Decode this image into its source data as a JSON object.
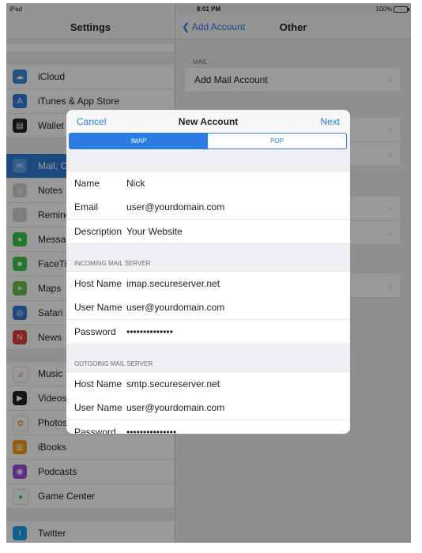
{
  "status_bar": {
    "device": "iPad",
    "time": "8:01 PM",
    "battery": "100%"
  },
  "settings": {
    "title": "Settings",
    "items": [
      {
        "label": "iCloud",
        "icon": "cloud-icon",
        "color": "#3d8bd6"
      },
      {
        "label": "iTunes & App Store",
        "icon": "app-store-icon",
        "color": "#2f7bd6"
      },
      {
        "label": "Wallet &",
        "icon": "wallet-icon",
        "color": "#222222"
      },
      {
        "label": "Mail, C",
        "icon": "mail-icon",
        "color": "#2f7bd6"
      },
      {
        "label": "Notes",
        "icon": "notes-icon",
        "color": "#d0d0d0"
      },
      {
        "label": "Remind",
        "icon": "reminders-icon",
        "color": "#d0d0d0"
      },
      {
        "label": "Messag",
        "icon": "messages-icon",
        "color": "#3cc84b"
      },
      {
        "label": "FaceTim",
        "icon": "facetime-icon",
        "color": "#3cc84b"
      },
      {
        "label": "Maps",
        "icon": "maps-icon",
        "color": "#6cbd4b"
      },
      {
        "label": "Safari",
        "icon": "safari-icon",
        "color": "#2f7bd6"
      },
      {
        "label": "News",
        "icon": "news-icon",
        "color": "#e43d3d"
      },
      {
        "label": "Music",
        "icon": "music-icon",
        "color": "#ffffff"
      },
      {
        "label": "Videos",
        "icon": "videos-icon",
        "color": "#222222"
      },
      {
        "label": "Photos",
        "icon": "photos-icon",
        "color": "#ffffff"
      },
      {
        "label": "iBooks",
        "icon": "ibooks-icon",
        "color": "#f39c1a"
      },
      {
        "label": "Podcasts",
        "icon": "podcasts-icon",
        "color": "#9b4ddf"
      },
      {
        "label": "Game Center",
        "icon": "game-center-icon",
        "color": "#ffffff"
      },
      {
        "label": "Twitter",
        "icon": "twitter-icon",
        "color": "#1da1f2"
      }
    ]
  },
  "other": {
    "back_label": "Add Account",
    "title": "Other",
    "mail_caption": "MAIL",
    "add_mail_account": "Add Mail Account"
  },
  "modal": {
    "cancel": "Cancel",
    "title": "New Account",
    "next": "Next",
    "segments": [
      "IMAP",
      "POP"
    ],
    "selected_segment": "IMAP",
    "account_fields": [
      {
        "label": "Name",
        "value": "Nick"
      },
      {
        "label": "Email",
        "value": "user@yourdomain.com"
      },
      {
        "label": "Description",
        "value": "Your Website"
      }
    ],
    "incoming_caption": "INCOMING MAIL SERVER",
    "incoming_fields": [
      {
        "label": "Host Name",
        "value": "imap.secureserver.net"
      },
      {
        "label": "User Name",
        "value": "user@yourdomain.com"
      },
      {
        "label": "Password",
        "value": "••••••••••••••"
      }
    ],
    "outgoing_caption": "OUTGOING MAIL SERVER",
    "outgoing_fields": [
      {
        "label": "Host Name",
        "value": "smtp.secureserver.net"
      },
      {
        "label": "User Name",
        "value": "user@yourdomain.com"
      },
      {
        "label": "Password",
        "value": "•••••••••••••••"
      }
    ]
  },
  "colors": {
    "accent": "#2b7de1",
    "overlay": "rgba(0,0,0,0.40)"
  }
}
